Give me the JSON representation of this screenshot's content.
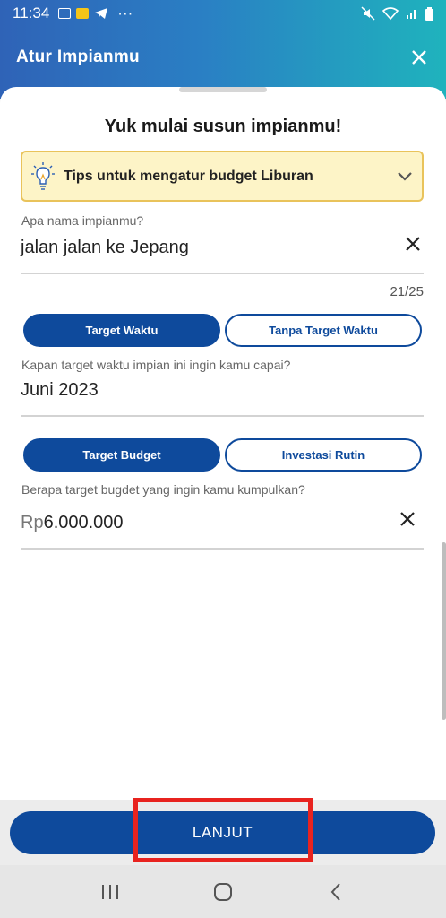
{
  "status": {
    "time": "11:34",
    "more": "···"
  },
  "appbar": {
    "title": "Atur Impianmu"
  },
  "sheet": {
    "title": "Yuk mulai susun impianmu!"
  },
  "tips": {
    "label": "Tips untuk mengatur budget Liburan"
  },
  "dream_name": {
    "label": "Apa nama impianmu?",
    "value": "jalan jalan ke Jepang",
    "counter": "21/25"
  },
  "time_toggle": {
    "options": [
      "Target Waktu",
      "Tanpa Target Waktu"
    ],
    "selected": "Target Waktu"
  },
  "target_time": {
    "label": "Kapan target waktu impian ini ingin kamu capai?",
    "value": "Juni 2023"
  },
  "budget_toggle": {
    "options": [
      "Target Budget",
      "Investasi Rutin"
    ],
    "selected": "Target Budget"
  },
  "budget": {
    "label": "Berapa target bugdet yang ingin kamu kumpulkan?",
    "prefix": "Rp",
    "value": "6.000.000"
  },
  "actions": {
    "next_label": "LANJUT"
  },
  "colors": {
    "primary": "#0e4a9c",
    "tips_bg": "#fdf4c7",
    "tips_border": "#e9c35b",
    "highlight": "#e8231f"
  }
}
